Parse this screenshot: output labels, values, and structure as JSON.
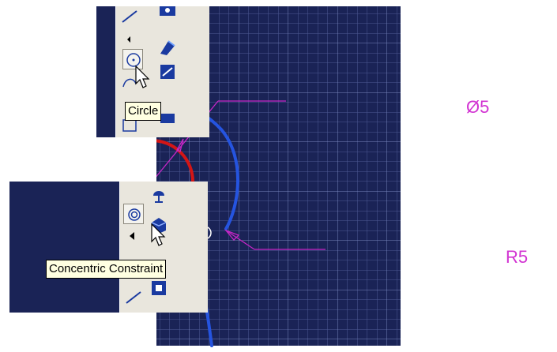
{
  "tooltips": {
    "circle": "Circle",
    "concentric": "Concentric Constraint"
  },
  "dimensions": {
    "diameter": "Ø5",
    "radius": "R5"
  },
  "colors": {
    "canvas_background": "#1a2356",
    "grid": "#6e7bb0",
    "arc": "#2554e0",
    "circle": "#d41616",
    "dimension": "#d233d2",
    "point": "#2ee02e",
    "toolbar": "#e9e6dd"
  }
}
